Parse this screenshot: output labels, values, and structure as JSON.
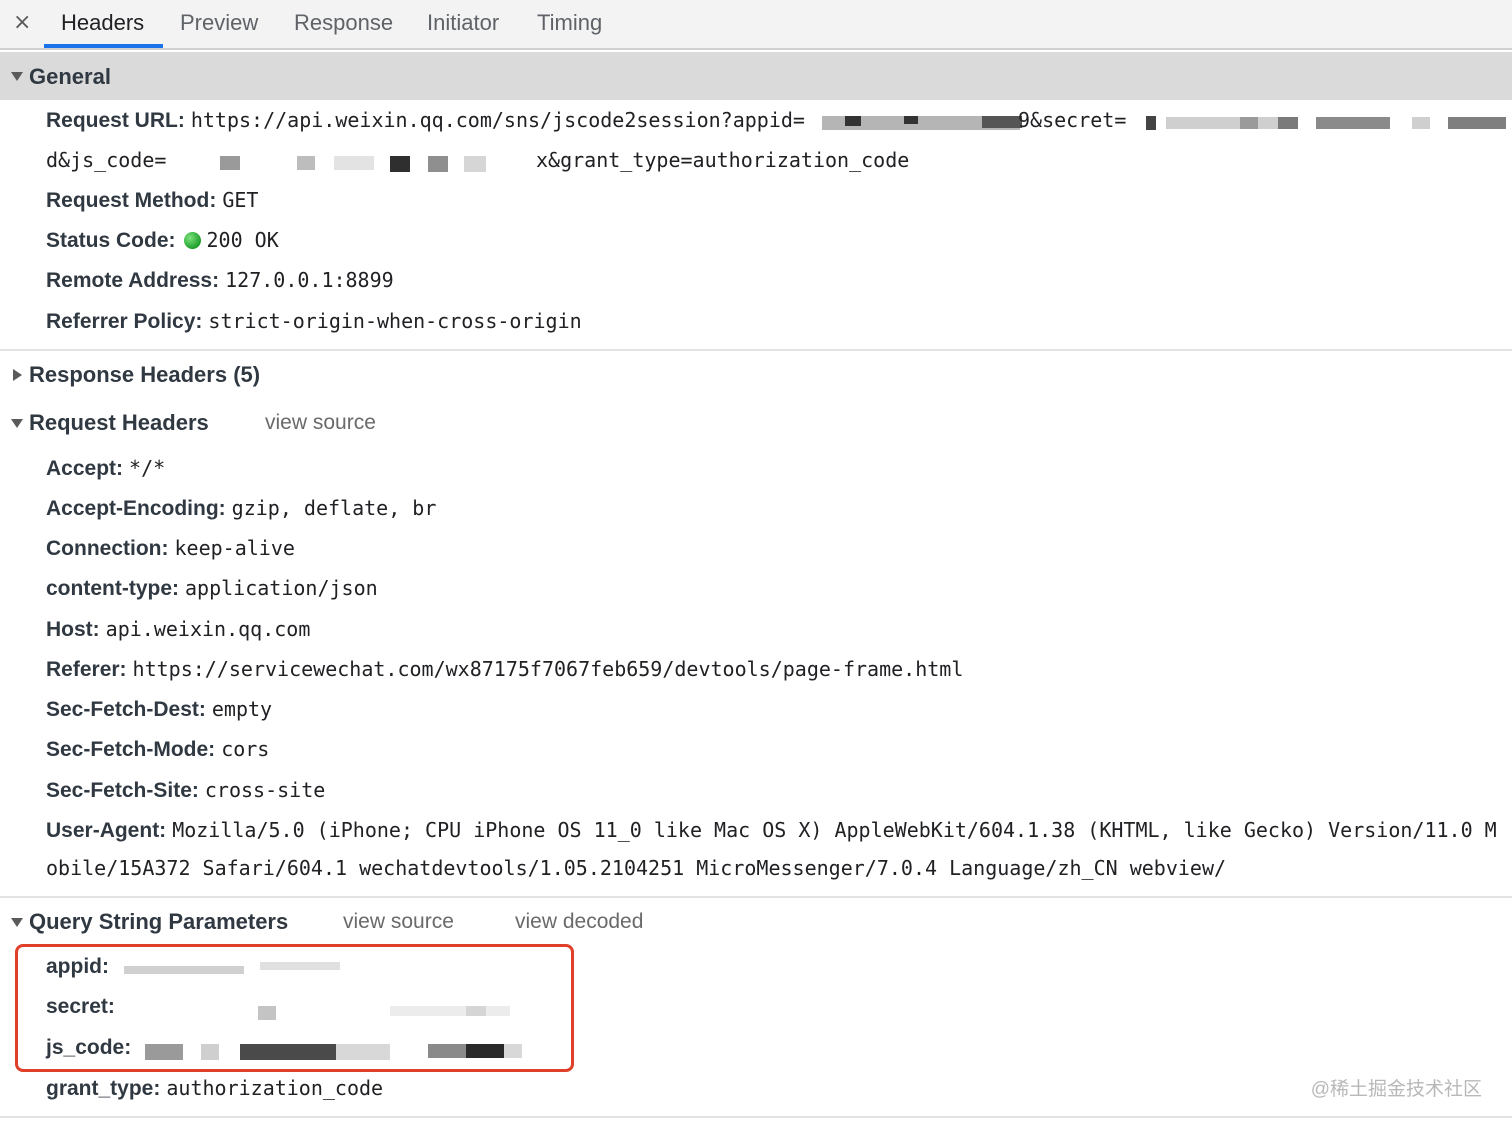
{
  "tabs": {
    "close": "×",
    "items": [
      "Headers",
      "Preview",
      "Response",
      "Initiator",
      "Timing"
    ]
  },
  "general": {
    "title": "General",
    "request_url_key": "Request URL:",
    "request_url_line1": "https://api.weixin.qq.com/sns/jscode2session?appid=",
    "request_url_mid": "9&secret=",
    "request_url_line2_prefix": "d&js_code=",
    "request_url_line2_suffix": "x&grant_type=authorization_code",
    "method_key": "Request Method:",
    "method_val": "GET",
    "status_key": "Status Code:",
    "status_val": "200 OK",
    "remote_key": "Remote Address:",
    "remote_val": "127.0.0.1:8899",
    "referrer_key": "Referrer Policy:",
    "referrer_val": "strict-origin-when-cross-origin"
  },
  "response_headers": {
    "title": "Response Headers (5)"
  },
  "request_headers": {
    "title": "Request Headers",
    "view_source": "view source",
    "items": [
      {
        "k": "Accept:",
        "v": "*/*"
      },
      {
        "k": "Accept-Encoding:",
        "v": "gzip, deflate, br"
      },
      {
        "k": "Connection:",
        "v": "keep-alive"
      },
      {
        "k": "content-type:",
        "v": "application/json"
      },
      {
        "k": "Host:",
        "v": "api.weixin.qq.com"
      },
      {
        "k": "Referer:",
        "v": "https://servicewechat.com/wx87175f7067feb659/devtools/page-frame.html"
      },
      {
        "k": "Sec-Fetch-Dest:",
        "v": "empty"
      },
      {
        "k": "Sec-Fetch-Mode:",
        "v": "cors"
      },
      {
        "k": "Sec-Fetch-Site:",
        "v": "cross-site"
      },
      {
        "k": "User-Agent:",
        "v": "Mozilla/5.0 (iPhone; CPU iPhone OS 11_0 like Mac OS X) AppleWebKit/604.1.38 (KHTML, like Gecko) Version/11.0 M"
      }
    ],
    "ua_line2": "obile/15A372 Safari/604.1 wechatdevtools/1.05.2104251 MicroMessenger/7.0.4 Language/zh_CN webview/"
  },
  "query": {
    "title": "Query String Parameters",
    "view_source": "view source",
    "view_decoded": "view decoded",
    "appid_key": "appid:",
    "secret_key": "secret:",
    "js_code_key": "js_code:",
    "grant_key": "grant_type:",
    "grant_val": "authorization_code"
  },
  "watermark": "@稀土掘金技术社区",
  "colors": {
    "accent": "#1a73e8",
    "highlight_box": "#e0402a",
    "status_ok": "#1f9e2b"
  }
}
